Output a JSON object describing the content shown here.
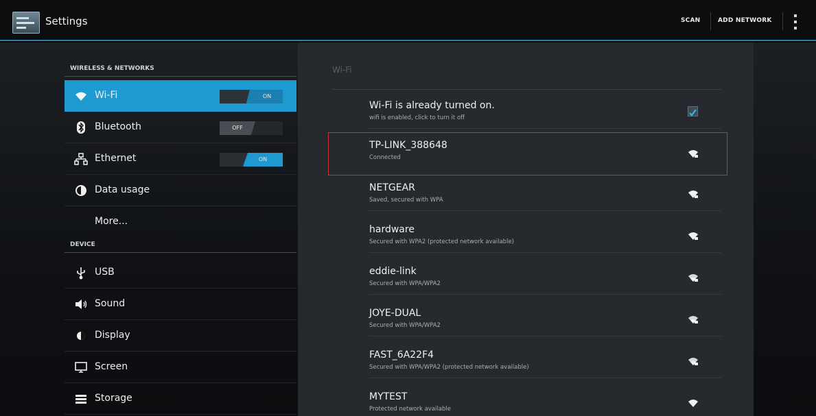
{
  "actionbar": {
    "title": "Settings",
    "scan_label": "SCAN",
    "add_network_label": "ADD NETWORK"
  },
  "sidebar": {
    "wireless_header": "WIRELESS & NETWORKS",
    "device_header": "DEVICE",
    "items": [
      {
        "label": "Wi-Fi",
        "icon": "wifi-icon",
        "toggle": "ON",
        "selected": true
      },
      {
        "label": "Bluetooth",
        "icon": "bluetooth-icon",
        "toggle": "OFF"
      },
      {
        "label": "Ethernet",
        "icon": "ethernet-icon",
        "toggle": "ON"
      },
      {
        "label": "Data usage",
        "icon": "data-usage-icon"
      },
      {
        "label": "More..."
      },
      {
        "label": "USB",
        "icon": "usb-icon"
      },
      {
        "label": "Sound",
        "icon": "sound-icon"
      },
      {
        "label": "Display",
        "icon": "display-icon"
      },
      {
        "label": "Screen",
        "icon": "screen-icon"
      },
      {
        "label": "Storage",
        "icon": "storage-icon"
      }
    ]
  },
  "wifi": {
    "heading": "Wi-Fi",
    "enable_row": {
      "title": "Wi-Fi is already turned on.",
      "summary": "wifi is enabled, click to turn it off",
      "checked": true
    },
    "networks": [
      {
        "ssid": "TP-LINK_388648",
        "status": "Connected"
      },
      {
        "ssid": "NETGEAR",
        "status": "Saved, secured with WPA"
      },
      {
        "ssid": "hardware",
        "status": "Secured with WPA2 (protected network available)"
      },
      {
        "ssid": "eddie-link",
        "status": "Secured with WPA/WPA2"
      },
      {
        "ssid": "JOYE-DUAL",
        "status": "Secured with WPA/WPA2"
      },
      {
        "ssid": "FAST_6A22F4",
        "status": "Secured with WPA/WPA2 (protected network available)"
      },
      {
        "ssid": "MYTEST",
        "status": "Protected network available"
      }
    ]
  },
  "colors": {
    "accent": "#1e9ad0",
    "highlight_border": "#c8323a"
  }
}
